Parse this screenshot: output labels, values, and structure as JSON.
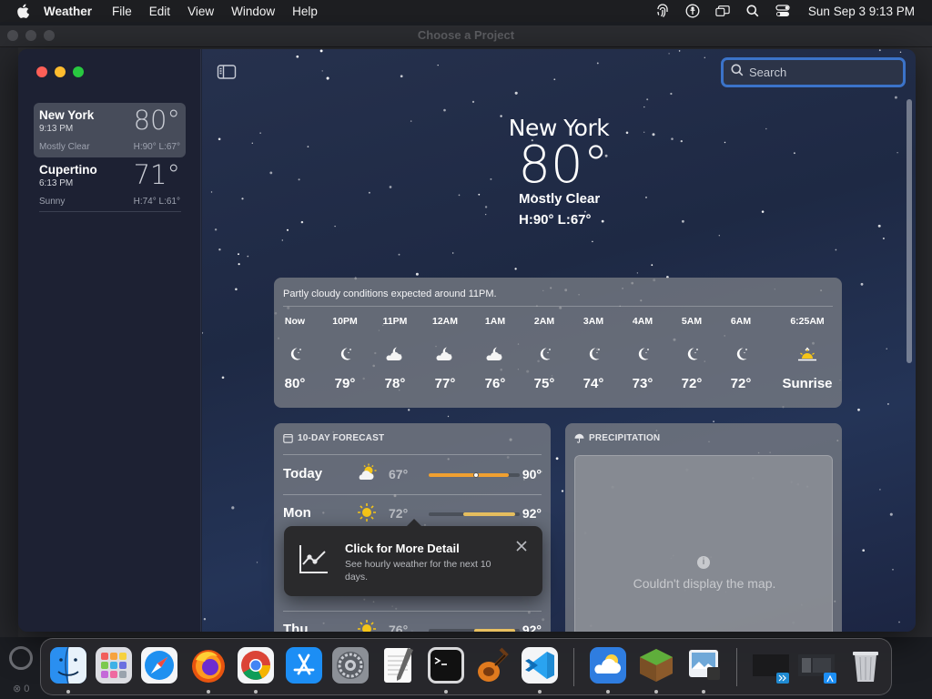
{
  "menubar": {
    "app_name": "Weather",
    "items": [
      "File",
      "Edit",
      "View",
      "Window",
      "Help"
    ],
    "clock": "Sun Sep 3  9:13 PM"
  },
  "background_window": {
    "title": "Choose a Project",
    "status": "⊗ 0"
  },
  "sidebar": {
    "locations": [
      {
        "name": "New York",
        "time": "9:13 PM",
        "temp": "80°",
        "condition": "Mostly Clear",
        "hilo": "H:90°  L:67°",
        "selected": true
      },
      {
        "name": "Cupertino",
        "time": "6:13 PM",
        "temp": "71°",
        "condition": "Sunny",
        "hilo": "H:74°  L:61°",
        "selected": false
      }
    ]
  },
  "search": {
    "placeholder": "Search"
  },
  "current": {
    "city": "New York",
    "temp": "80°",
    "condition": "Mostly Clear",
    "hilo": "H:90°  L:67°"
  },
  "hourly": {
    "note": "Partly cloudy conditions expected around 11PM.",
    "hours": [
      {
        "label": "Now",
        "icon": "moon-clear-icon",
        "temp": "80°"
      },
      {
        "label": "10PM",
        "icon": "moon-clear-icon",
        "temp": "79°"
      },
      {
        "label": "11PM",
        "icon": "cloud-moon-icon",
        "temp": "78°"
      },
      {
        "label": "12AM",
        "icon": "cloud-moon-icon",
        "temp": "77°"
      },
      {
        "label": "1AM",
        "icon": "cloud-moon-icon",
        "temp": "76°"
      },
      {
        "label": "2AM",
        "icon": "moon-clear-icon",
        "temp": "75°"
      },
      {
        "label": "3AM",
        "icon": "moon-clear-icon",
        "temp": "74°"
      },
      {
        "label": "4AM",
        "icon": "moon-clear-icon",
        "temp": "73°"
      },
      {
        "label": "5AM",
        "icon": "moon-clear-icon",
        "temp": "72°"
      },
      {
        "label": "6AM",
        "icon": "moon-clear-icon",
        "temp": "72°"
      },
      {
        "label": "6:25AM",
        "icon": "sunrise-icon",
        "temp": "Sunrise"
      }
    ]
  },
  "forecast": {
    "header": "10-DAY FORECAST",
    "days": [
      {
        "day": "Today",
        "icon": "partly-sunny-icon",
        "low": "67°",
        "high": "90°",
        "bar_start": 0.0,
        "bar_end": 0.88,
        "current": 0.52,
        "bar_color": "#f0a030"
      },
      {
        "day": "Mon",
        "icon": "sun-icon",
        "low": "72°",
        "high": "92°",
        "bar_start": 0.38,
        "bar_end": 0.95,
        "current": null,
        "bar_color": "#e8c060"
      },
      {
        "day": "Thu",
        "icon": "sun-icon",
        "low": "76°",
        "high": "92°",
        "bar_start": 0.5,
        "bar_end": 0.95,
        "current": null,
        "bar_color": "#e8c060"
      }
    ]
  },
  "precipitation": {
    "header": "PRECIPITATION",
    "message": "Couldn't display the map."
  },
  "tooltip": {
    "title": "Click for More Detail",
    "body": "See hourly weather for the next 10 days."
  },
  "dock": {
    "apps": [
      "Finder",
      "Launchpad",
      "Safari",
      "Firefox",
      "Chrome",
      "App Store",
      "System Settings",
      "TextEdit",
      "Terminal",
      "GarageBand",
      "Visual Studio Code",
      "Weather",
      "Minecraft",
      "Preview",
      "Xcode Window",
      "App Store Window",
      "Trash"
    ]
  }
}
